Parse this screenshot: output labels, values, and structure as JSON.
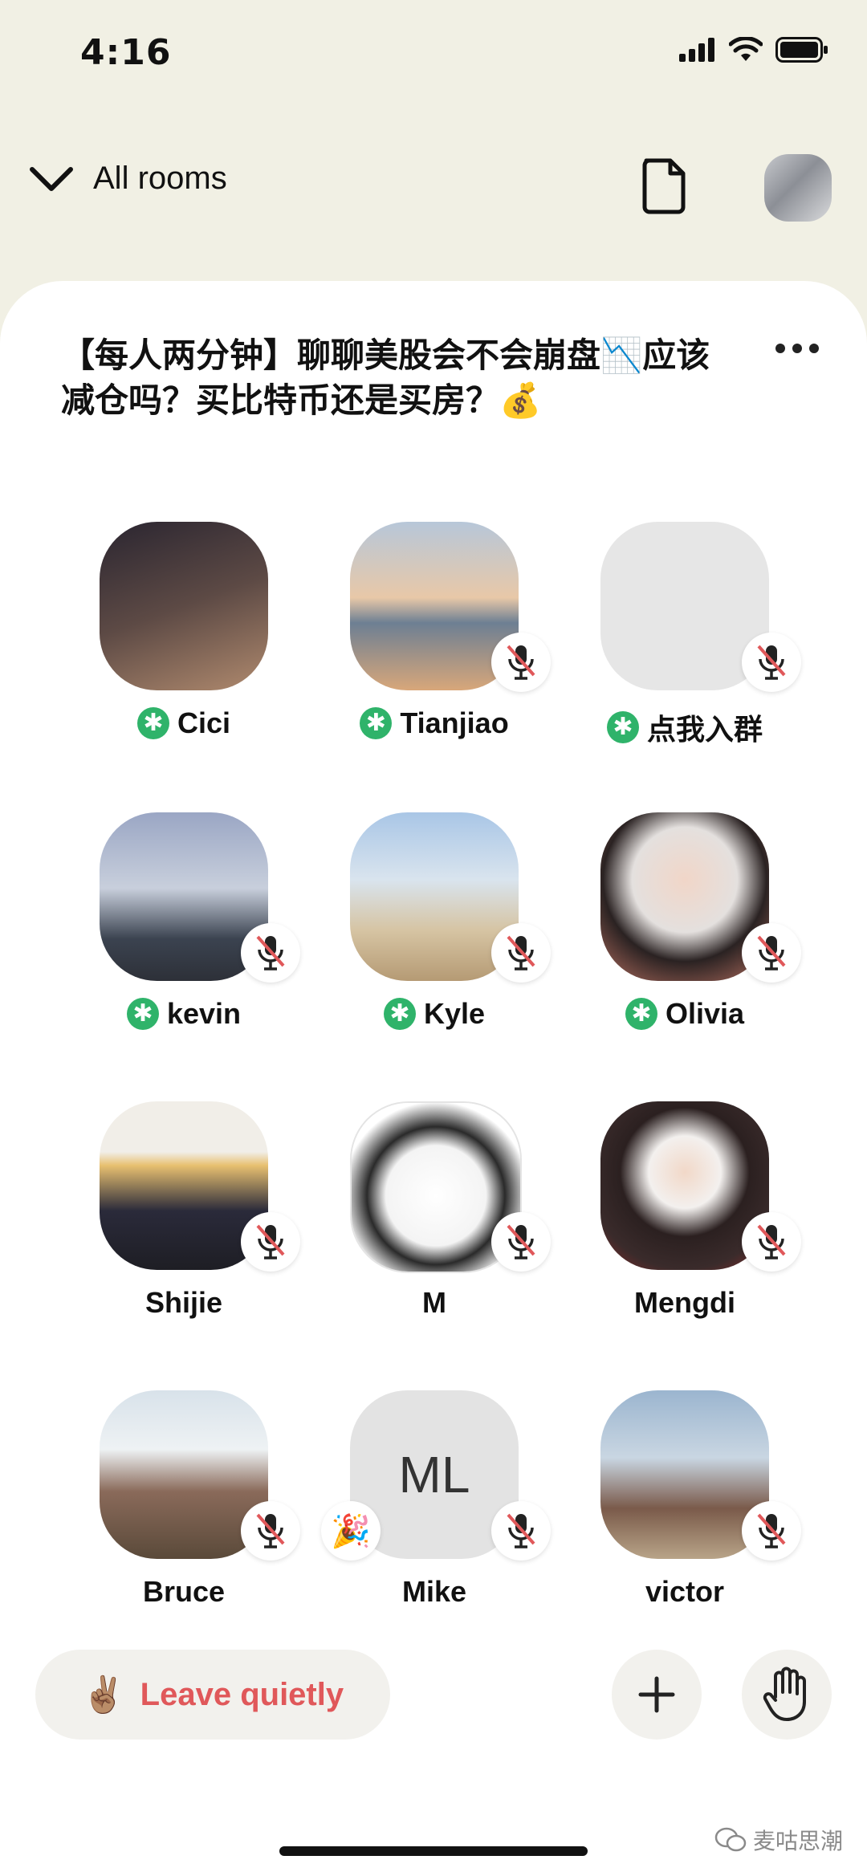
{
  "status_bar": {
    "time": "4:16"
  },
  "top_bar": {
    "back_label": "All rooms"
  },
  "room": {
    "title": "【每人两分钟】聊聊美股会不会崩盘📉应该减仓吗？买比特币还是买房？💰"
  },
  "speakers": [
    {
      "name": "Cici",
      "moderator": true,
      "muted": false,
      "colors": [
        "#2a2530",
        "#b08a6e"
      ]
    },
    {
      "name": "Tianjiao",
      "moderator": true,
      "muted": true,
      "colors": [
        "#b7c7d9",
        "#d8a77a"
      ]
    },
    {
      "name": "点我入群",
      "moderator": true,
      "muted": true,
      "colors": [
        "#e6e6e6",
        "#e6e6e6"
      ]
    },
    {
      "name": "kevin",
      "moderator": true,
      "muted": true,
      "colors": [
        "#9aa6c4",
        "#3b4350"
      ]
    },
    {
      "name": "Kyle",
      "moderator": true,
      "muted": true,
      "colors": [
        "#a9c6e6",
        "#d6c4a3"
      ]
    },
    {
      "name": "Olivia",
      "moderator": true,
      "muted": true,
      "colors": [
        "#e4e0de",
        "#b66f60"
      ]
    },
    {
      "name": "Shijie",
      "moderator": false,
      "muted": true,
      "colors": [
        "#f1eee8",
        "#2a2a3a"
      ]
    },
    {
      "name": "M",
      "moderator": false,
      "muted": true,
      "colors": [
        "#ffffff",
        "#9a9a9a"
      ]
    },
    {
      "name": "Mengdi",
      "moderator": false,
      "muted": true,
      "colors": [
        "#f3f0ee",
        "#3a2b2b"
      ]
    },
    {
      "name": "Bruce",
      "moderator": false,
      "muted": true,
      "colors": [
        "#d8e2ea",
        "#8a6a5a"
      ]
    },
    {
      "name": "Mike",
      "moderator": false,
      "muted": true,
      "initials": "ML",
      "badge": "🎉",
      "colors": [
        "#e3e3e3",
        "#e3e3e3"
      ]
    },
    {
      "name": "victor",
      "moderator": false,
      "muted": true,
      "colors": [
        "#9bb5cf",
        "#7a5a4a"
      ]
    }
  ],
  "bottom_bar": {
    "leave_emoji": "✌🏽",
    "leave_label": "Leave quietly"
  },
  "watermark": {
    "text": "麦咕思潮"
  },
  "theme": {
    "accent_red": "#e0585a",
    "moderator_green": "#2fb36a",
    "background": "#f1f0e4"
  }
}
